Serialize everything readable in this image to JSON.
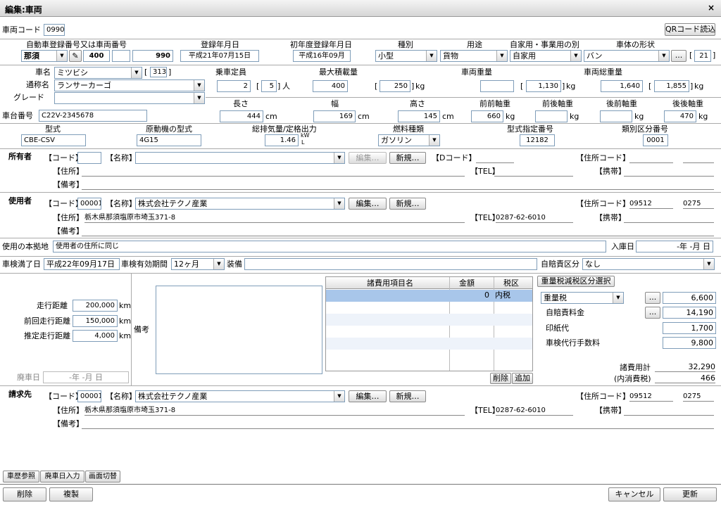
{
  "window": {
    "title": "編集:車両",
    "close": "×"
  },
  "top": {
    "code_label": "車両コード",
    "code": "0990",
    "qr_button": "QRコード読込"
  },
  "reg": {
    "header": "自動車登録番号又は車両番号",
    "area": "那須",
    "class": "400",
    "kana": "",
    "number": "990"
  },
  "reg_date": {
    "header": "登録年月日",
    "value": "平成21年07月15日"
  },
  "first_reg": {
    "header": "初年度登録年月日",
    "value": "平成16年09月"
  },
  "kind": {
    "header": "種別",
    "value": "小型"
  },
  "usage": {
    "header": "用途",
    "value": "貨物"
  },
  "private": {
    "header": "自家用・事業用の別",
    "value": "自家用"
  },
  "body_shape": {
    "header": "車体の形状",
    "value": "バン",
    "code": "21",
    "dots": "..."
  },
  "maker": {
    "label": "車名",
    "value": "ミツビシ",
    "code": "313"
  },
  "model_name": {
    "label": "通称名",
    "value": "ランサーカーゴ"
  },
  "grade": {
    "label": "グレード",
    "value": ""
  },
  "capacity": {
    "header": "乗車定員",
    "value": "2",
    "sub": "5",
    "unit": "人"
  },
  "max_load": {
    "header": "最大積載量",
    "value": "400",
    "sub": "250",
    "unit": "kg"
  },
  "weight": {
    "header": "車両重量",
    "value": "",
    "sub": "1,130",
    "unit": "kg"
  },
  "gross": {
    "header": "車両総重量",
    "value": "1,640",
    "sub": "1,855",
    "unit": "kg"
  },
  "chassis": {
    "label": "車台番号",
    "value": "C22V-2345678"
  },
  "dims": {
    "length_h": "長さ",
    "length": "444",
    "width_h": "幅",
    "width": "169",
    "height_h": "高さ",
    "height": "145",
    "unit": "cm"
  },
  "axles": {
    "ff_h": "前前軸重",
    "ff": "660",
    "fr_h": "前後軸重",
    "fr": "",
    "rf_h": "後前軸重",
    "rf": "",
    "rr_h": "後後軸重",
    "rr": "470",
    "unit": "kg"
  },
  "spec": {
    "model_h": "型式",
    "model": "CBE-CSV",
    "engine_h": "原動機の型式",
    "engine": "4G15",
    "disp_h": "総排気量/定格出力",
    "disp": "1.46",
    "disp_u1": "kW",
    "disp_u2": "L",
    "fuel_h": "燃料種類",
    "fuel": "ガソリン",
    "type_no_h": "型式指定番号",
    "type_no": "12182",
    "cat_no_h": "類別区分番号",
    "cat_no": "0001"
  },
  "owner": {
    "title": "所有者",
    "code_l": "【コード】",
    "code": "",
    "name_l": "【名称】",
    "name": "",
    "edit": "編集…",
    "new": "新規…",
    "d_code_l": "【Dコード】",
    "addr_code_l": "【住所コード】",
    "addr_l": "【住所】",
    "addr": "",
    "tel_l": "【TEL】",
    "tel": "",
    "mob_l": "【携帯】",
    "note_l": "【備考】"
  },
  "user": {
    "title": "使用者",
    "code_l": "【コード】",
    "code": "00001",
    "name_l": "【名称】",
    "name": "株式会社テクノ産業",
    "edit": "編集…",
    "new": "新規…",
    "addr_code_l": "【住所コード】",
    "addr_code1": "09512",
    "addr_code2": "0275",
    "addr_l": "【住所】",
    "addr": "栃木県那須塩原市埼玉371-8",
    "tel_l": "【TEL】",
    "tel": "0287-62-6010",
    "mob_l": "【携帯】",
    "note_l": "【備考】"
  },
  "base": {
    "label": "使用の本拠地",
    "value": "使用者の住所に同じ",
    "in_label": "入庫日",
    "in_value": "-年 -月 日"
  },
  "inspection": {
    "label": "車検満了日",
    "value": "平成22年09月17日",
    "period_l": "車検有効期間",
    "period": "12ヶ月",
    "equip_l": "装備",
    "insurance_l": "自賠責区分",
    "insurance": "なし"
  },
  "mileage": {
    "run_l": "走行距離",
    "run": "200,000",
    "prev_l": "前回走行距離",
    "prev": "150,000",
    "est_l": "推定走行距離",
    "est": "4,000",
    "unit": "km",
    "note_l": "備考",
    "scrap_l": "廃車日",
    "scrap": "-年 -月 日"
  },
  "fees": {
    "col_item": "諸費用項目名",
    "col_amount": "金額",
    "col_tax": "税区",
    "rows": [
      {
        "item": "",
        "amount": "0",
        "tax": "内税"
      }
    ],
    "delete": "削除",
    "add": "追加"
  },
  "tax": {
    "reduce_btn": "重量税減税区分選択",
    "weight_tax": "重量税",
    "weight_tax_amt": "6,600",
    "liab_l": "自賠責料金",
    "liab": "14,190",
    "stamp_l": "印紙代",
    "stamp": "1,700",
    "agent_l": "車検代行手数料",
    "agent": "9,800",
    "total_l": "諸費用計",
    "total": "32,290",
    "tax_l": "(内消費税)",
    "tax": "466",
    "dots": "..."
  },
  "bill": {
    "title": "請求先",
    "code_l": "【コード】",
    "code": "00001",
    "name_l": "【名称】",
    "name": "株式会社テクノ産業",
    "edit": "編集…",
    "new": "新規…",
    "addr_code_l": "【住所コード】",
    "addr_code1": "09512",
    "addr_code2": "0275",
    "addr_l": "【住所】",
    "addr": "栃木県那須塩原市埼玉371-8",
    "tel_l": "【TEL】",
    "tel": "0287-62-6010",
    "mob_l": "【携帯】",
    "note_l": "【備考】"
  },
  "tabs": [
    "車歴参照",
    "廃車日入力",
    "画面切替"
  ],
  "footer": {
    "delete": "削除",
    "copy": "複製",
    "cancel": "キャンセル",
    "update": "更新"
  }
}
